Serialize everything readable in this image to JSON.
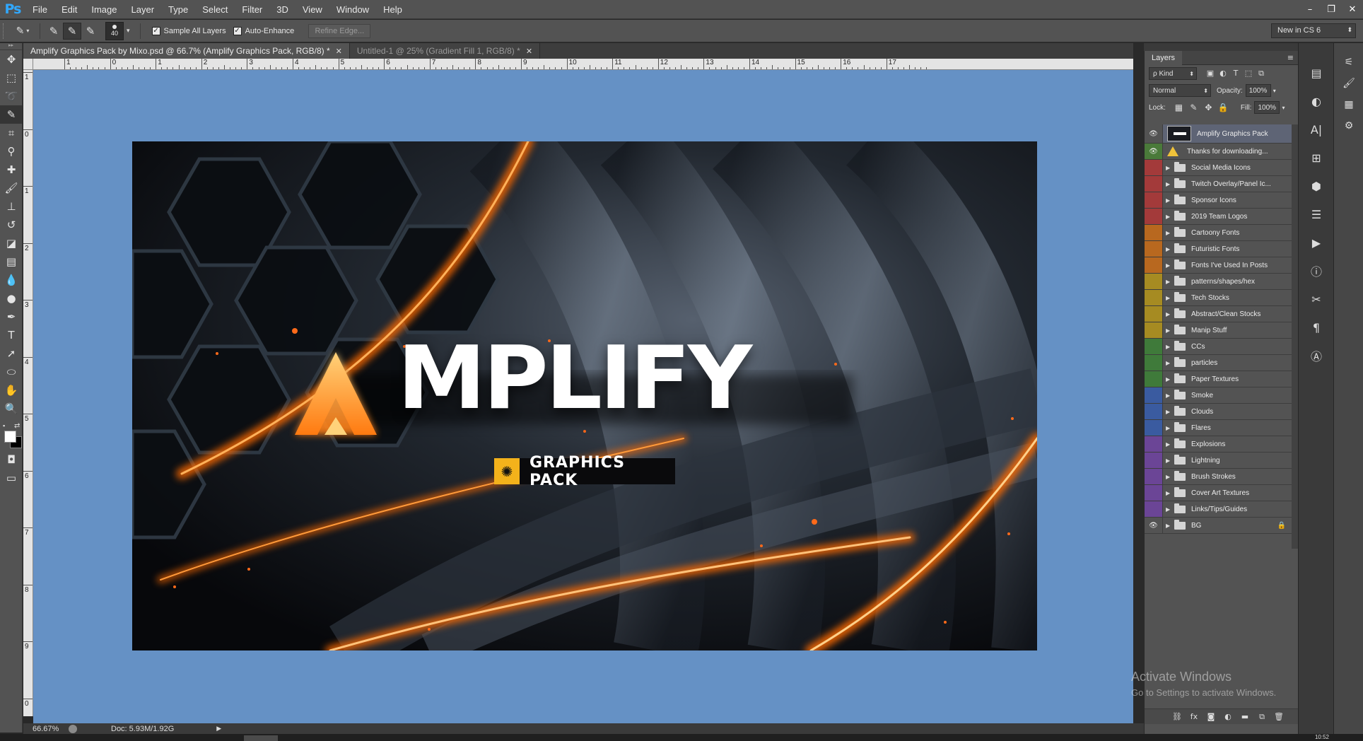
{
  "app": {
    "logo": "Ps"
  },
  "menu": [
    "File",
    "Edit",
    "Image",
    "Layer",
    "Type",
    "Select",
    "Filter",
    "3D",
    "View",
    "Window",
    "Help"
  ],
  "window_controls": {
    "minimize": "–",
    "restore": "❐",
    "close": "✕"
  },
  "options": {
    "brush_size": "40",
    "sample_all_layers": {
      "label": "Sample All Layers",
      "checked": true
    },
    "auto_enhance": {
      "label": "Auto-Enhance",
      "checked": true
    },
    "refine_edge": "Refine Edge...",
    "workspace": "New in CS 6"
  },
  "tabs": [
    {
      "title": "Amplify Graphics Pack by Mixo.psd @ 66.7% (Amplify Graphics Pack, RGB/8) *",
      "active": true
    },
    {
      "title": "Untitled-1 @ 25% (Gradient Fill 1, RGB/8) *",
      "active": false
    }
  ],
  "rulers": {
    "horizontal": [
      "1",
      "0",
      "1",
      "2",
      "3",
      "4",
      "5",
      "6",
      "7",
      "8",
      "9",
      "10",
      "11",
      "12",
      "13",
      "14",
      "15",
      "16",
      "17"
    ],
    "vertical": [
      "1",
      "0",
      "1",
      "2",
      "3",
      "4",
      "5",
      "6",
      "7",
      "8",
      "9",
      "0"
    ]
  },
  "artwork": {
    "title": "AMPLIFY",
    "title_rest": "MPLIFY",
    "subtitle": "GRAPHICS PACK",
    "accent": "#ff7a1a",
    "background": "#0c0e12"
  },
  "status": {
    "zoom": "66.67%",
    "doc": "Doc: 5.93M/1.92G",
    "arrow": "▶",
    "clock": "10:52"
  },
  "layers_panel": {
    "tab": "Layers",
    "kind": "ρ Kind",
    "blend_mode": "Normal",
    "opacity_label": "Opacity:",
    "opacity": "100%",
    "lock_label": "Lock:",
    "fill_label": "Fill:",
    "fill": "100%",
    "layers": [
      {
        "name": "Amplify Graphics Pack",
        "type": "image",
        "color": "#535353",
        "visible": true,
        "selected": true
      },
      {
        "name": "Thanks for downloading...",
        "type": "warning",
        "color": "#4a7a3a",
        "visible": true
      },
      {
        "name": "Social Media Icons",
        "type": "folder",
        "color": "#a33a3a",
        "visible": false
      },
      {
        "name": "Twitch Overlay/Panel Ic...",
        "type": "folder",
        "color": "#a33a3a",
        "visible": false
      },
      {
        "name": "Sponsor Icons",
        "type": "folder",
        "color": "#a33a3a",
        "visible": false
      },
      {
        "name": "2019 Team Logos",
        "type": "folder",
        "color": "#a33a3a",
        "visible": false
      },
      {
        "name": "Cartoony Fonts",
        "type": "folder",
        "color": "#b8681f",
        "visible": false
      },
      {
        "name": "Futuristic Fonts",
        "type": "folder",
        "color": "#b8681f",
        "visible": false
      },
      {
        "name": "Fonts I've Used In Posts",
        "type": "folder",
        "color": "#b8681f",
        "visible": false
      },
      {
        "name": "patterns/shapes/hex",
        "type": "folder",
        "color": "#a68b22",
        "visible": false
      },
      {
        "name": "Tech Stocks",
        "type": "folder",
        "color": "#a68b22",
        "visible": false
      },
      {
        "name": "Abstract/Clean Stocks",
        "type": "folder",
        "color": "#a68b22",
        "visible": false
      },
      {
        "name": "Manip Stuff",
        "type": "folder",
        "color": "#a68b22",
        "visible": false
      },
      {
        "name": "CCs",
        "type": "folder",
        "color": "#3f7a3a",
        "visible": false
      },
      {
        "name": "particles",
        "type": "folder",
        "color": "#3f7a3a",
        "visible": false
      },
      {
        "name": "Paper Textures",
        "type": "folder",
        "color": "#3f7a3a",
        "visible": false
      },
      {
        "name": "Smoke",
        "type": "folder",
        "color": "#3a5ba0",
        "visible": false
      },
      {
        "name": "Clouds",
        "type": "folder",
        "color": "#3a5ba0",
        "visible": false
      },
      {
        "name": "Flares",
        "type": "folder",
        "color": "#3a5ba0",
        "visible": false
      },
      {
        "name": "Explosions",
        "type": "folder",
        "color": "#6b4596",
        "visible": false
      },
      {
        "name": "Lightning",
        "type": "folder",
        "color": "#6b4596",
        "visible": false
      },
      {
        "name": "Brush Strokes",
        "type": "folder",
        "color": "#6b4596",
        "visible": false
      },
      {
        "name": "Cover Art Textures",
        "type": "folder",
        "color": "#6b4596",
        "visible": false
      },
      {
        "name": "Links/Tips/Guides",
        "type": "folder",
        "color": "#6b4596",
        "visible": false
      },
      {
        "name": "BG",
        "type": "folder",
        "color": "#535353",
        "visible": true,
        "locked": true
      }
    ]
  },
  "watermark": {
    "line1": "Activate Windows",
    "line2": "Go to Settings to activate Windows."
  }
}
